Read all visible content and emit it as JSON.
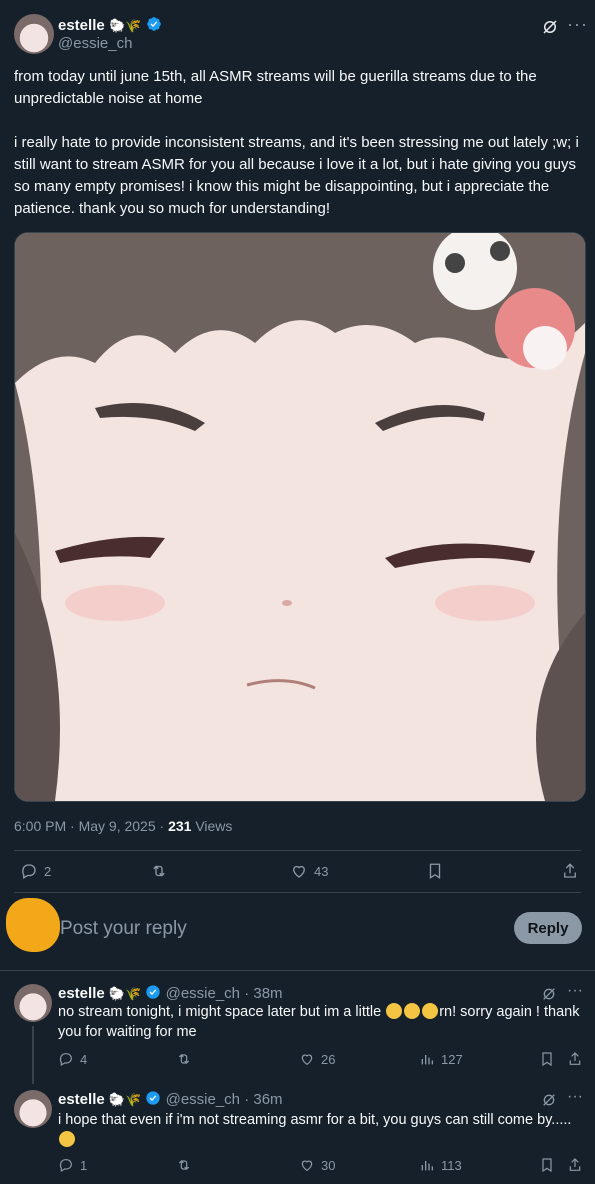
{
  "main_tweet": {
    "display_name": "estelle",
    "handle": "@essie_ch",
    "text_p1": "from today until june 15th, all ASMR streams will be guerilla streams due to the unpredictable noise at home",
    "text_p2": "i really hate to provide inconsistent streams, and it's been stressing me out lately ;w; i still want to stream ASMR for you all because i love it a lot, but i hate giving you guys so many empty promises! i know this might be disappointing, but i appreciate the patience. thank you so much for understanding!",
    "timestamp": "6:00 PM · May 9, 2025 · ",
    "views_count": "231",
    "views_label": " Views",
    "replies": "2",
    "likes": "43"
  },
  "composer": {
    "placeholder": "Post your reply",
    "reply_label": "Reply"
  },
  "replies": [
    {
      "display_name": "estelle",
      "handle": "@essie_ch",
      "time": "· 38m",
      "text_before": "no stream tonight, i might space later but im a little ",
      "text_after": "rn! sorry again ! thank you for waiting for me",
      "replies": "4",
      "likes": "26",
      "views": "127"
    },
    {
      "display_name": "estelle",
      "handle": "@essie_ch",
      "time": "· 36m",
      "text": "i hope that even if i'm not streaming asmr for a bit, you guys can still come by.....",
      "replies": "1",
      "likes": "30",
      "views": "113"
    }
  ],
  "colors": {
    "background": "#15202b",
    "muted": "#8b98a5",
    "verified": "#1d9bf0",
    "divider": "#38444d"
  }
}
